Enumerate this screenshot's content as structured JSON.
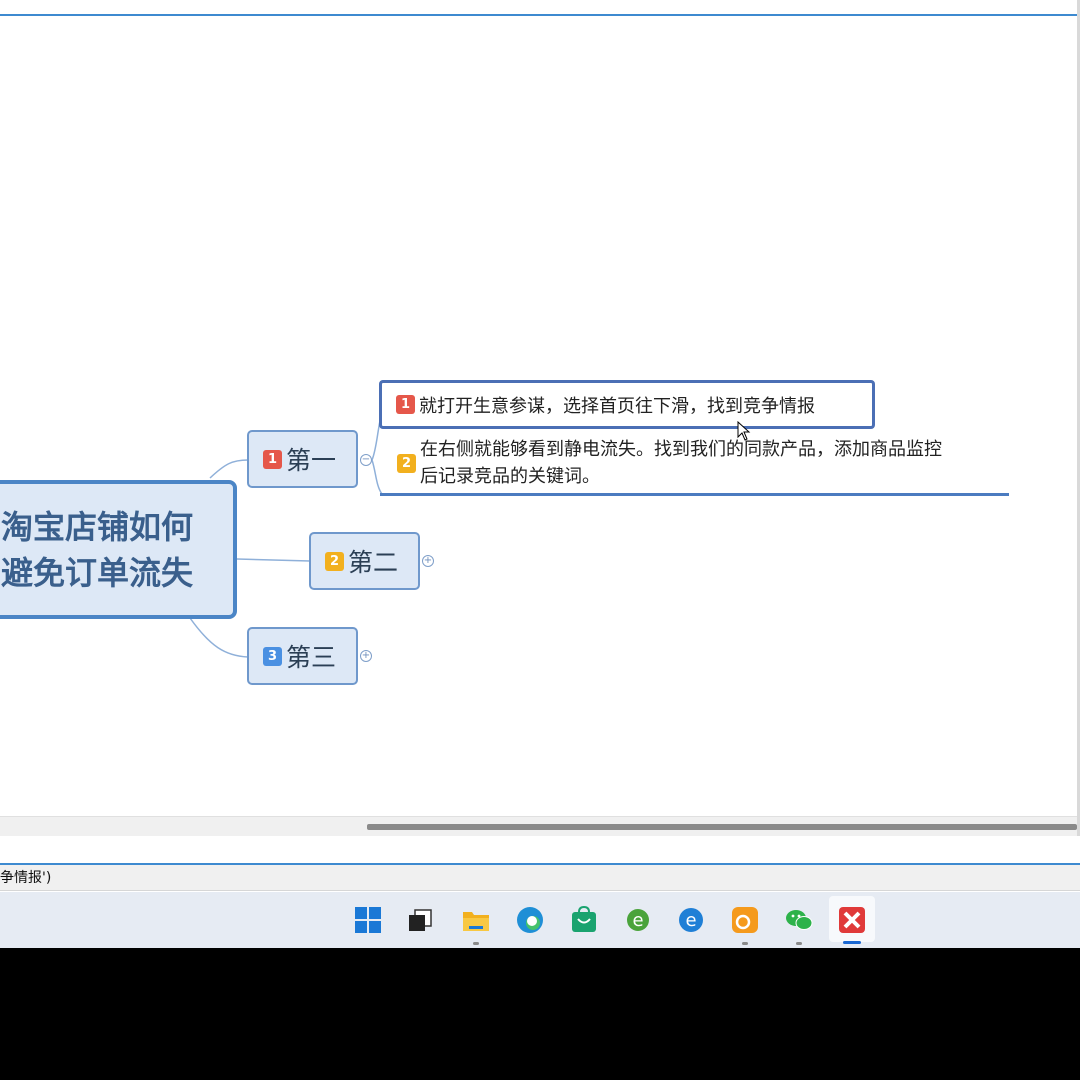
{
  "mindmap": {
    "central_line1": "淘宝店铺如何",
    "central_line2": "避免订单流失",
    "topics": [
      {
        "marker": "1",
        "label": "第一",
        "toggle": "−"
      },
      {
        "marker": "2",
        "label": "第二",
        "toggle": "+"
      },
      {
        "marker": "3",
        "label": "第三",
        "toggle": "+"
      }
    ],
    "subtopics": [
      {
        "marker": "1",
        "text": "就打开生意参谋，选择首页往下滑，找到竞争情报"
      },
      {
        "marker": "2",
        "line1": "在右侧就能够看到静电流失。找到我们的同款产品，添加商品监控",
        "line2": "后记录竞品的关键词。"
      }
    ]
  },
  "status": {
    "text": "争情报')"
  },
  "colors": {
    "topic_fill": "#dde8f6",
    "topic_border": "#6f98cc",
    "central_border": "#4b85c6",
    "marker_red": "#e5574a",
    "marker_yellow": "#f2b01e",
    "marker_blue": "#4a90e2",
    "selection": "#4b6fb5"
  },
  "taskbar": {
    "icons": [
      "windows-start-icon",
      "task-view-icon",
      "file-explorer-icon",
      "edge-icon",
      "store-icon",
      "ie-icon",
      "ie-blue-icon",
      "uc-browser-icon",
      "wechat-icon",
      "xmind-icon"
    ]
  }
}
